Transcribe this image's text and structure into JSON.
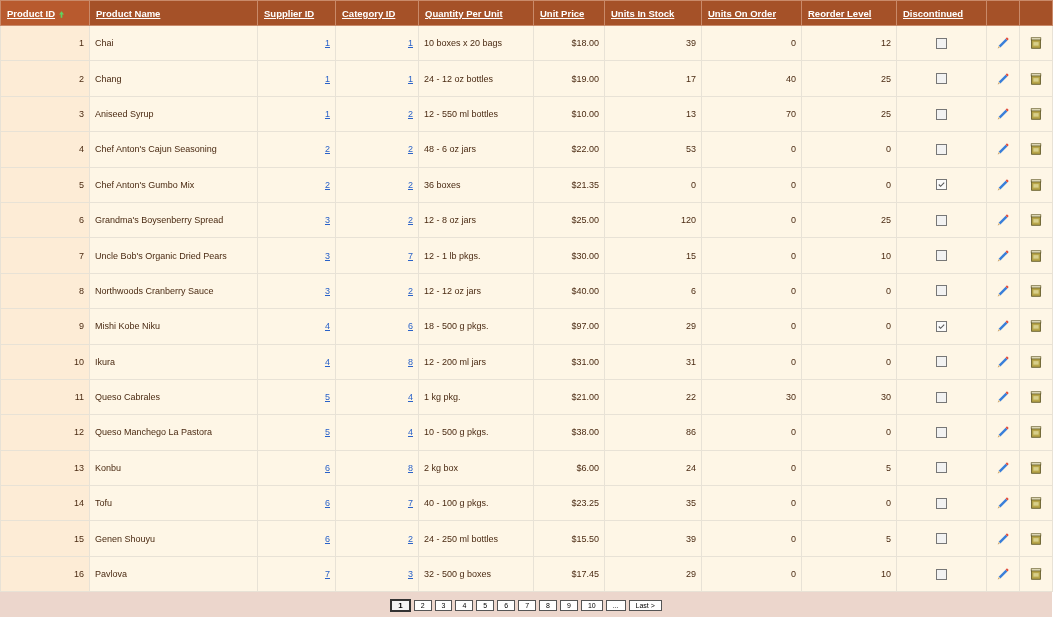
{
  "table": {
    "columns": [
      {
        "label": "Product ID",
        "sorted": true
      },
      {
        "label": "Product Name",
        "sorted": false
      },
      {
        "label": "Supplier ID",
        "sorted": false
      },
      {
        "label": "Category ID",
        "sorted": false
      },
      {
        "label": "Quantity Per Unit",
        "sorted": false
      },
      {
        "label": "Unit Price",
        "sorted": false
      },
      {
        "label": "Units In Stock",
        "sorted": false
      },
      {
        "label": "Units On Order",
        "sorted": false
      },
      {
        "label": "Reorder Level",
        "sorted": false
      },
      {
        "label": "Discontinued",
        "sorted": false
      }
    ],
    "rows": [
      {
        "cells": [
          "1",
          "Chai",
          "1",
          "1",
          "10 boxes x 20 bags",
          "$18.00",
          "39",
          "0",
          "12"
        ],
        "discontinued": false
      },
      {
        "cells": [
          "2",
          "Chang",
          "1",
          "1",
          "24 - 12 oz bottles",
          "$19.00",
          "17",
          "40",
          "25"
        ],
        "discontinued": false
      },
      {
        "cells": [
          "3",
          "Aniseed Syrup",
          "1",
          "2",
          "12 - 550 ml bottles",
          "$10.00",
          "13",
          "70",
          "25"
        ],
        "discontinued": false
      },
      {
        "cells": [
          "4",
          "Chef Anton's Cajun Seasoning",
          "2",
          "2",
          "48 - 6 oz jars",
          "$22.00",
          "53",
          "0",
          "0"
        ],
        "discontinued": false
      },
      {
        "cells": [
          "5",
          "Chef Anton's Gumbo Mix",
          "2",
          "2",
          "36 boxes",
          "$21.35",
          "0",
          "0",
          "0"
        ],
        "discontinued": true
      },
      {
        "cells": [
          "6",
          "Grandma's Boysenberry Spread",
          "3",
          "2",
          "12 - 8 oz jars",
          "$25.00",
          "120",
          "0",
          "25"
        ],
        "discontinued": false
      },
      {
        "cells": [
          "7",
          "Uncle Bob's Organic Dried Pears",
          "3",
          "7",
          "12 - 1 lb pkgs.",
          "$30.00",
          "15",
          "0",
          "10"
        ],
        "discontinued": false
      },
      {
        "cells": [
          "8",
          "Northwoods Cranberry Sauce",
          "3",
          "2",
          "12 - 12 oz jars",
          "$40.00",
          "6",
          "0",
          "0"
        ],
        "discontinued": false
      },
      {
        "cells": [
          "9",
          "Mishi Kobe Niku",
          "4",
          "6",
          "18 - 500 g pkgs.",
          "$97.00",
          "29",
          "0",
          "0"
        ],
        "discontinued": true
      },
      {
        "cells": [
          "10",
          "Ikura",
          "4",
          "8",
          "12 - 200 ml jars",
          "$31.00",
          "31",
          "0",
          "0"
        ],
        "discontinued": false
      },
      {
        "cells": [
          "11",
          "Queso Cabrales",
          "5",
          "4",
          "1 kg pkg.",
          "$21.00",
          "22",
          "30",
          "30"
        ],
        "discontinued": false
      },
      {
        "cells": [
          "12",
          "Queso Manchego La Pastora",
          "5",
          "4",
          "10 - 500 g pkgs.",
          "$38.00",
          "86",
          "0",
          "0"
        ],
        "discontinued": false
      },
      {
        "cells": [
          "13",
          "Konbu",
          "6",
          "8",
          "2 kg box",
          "$6.00",
          "24",
          "0",
          "5"
        ],
        "discontinued": false
      },
      {
        "cells": [
          "14",
          "Tofu",
          "6",
          "7",
          "40 - 100 g pkgs.",
          "$23.25",
          "35",
          "0",
          "0"
        ],
        "discontinued": false
      },
      {
        "cells": [
          "15",
          "Genen Shouyu",
          "6",
          "2",
          "24 - 250 ml bottles",
          "$15.50",
          "39",
          "0",
          "5"
        ],
        "discontinued": false
      },
      {
        "cells": [
          "16",
          "Pavlova",
          "7",
          "3",
          "32 - 500 g boxes",
          "$17.45",
          "29",
          "0",
          "10"
        ],
        "discontinued": false
      }
    ]
  },
  "pager": [
    {
      "label": "1",
      "selected": true
    },
    {
      "label": "2",
      "selected": false
    },
    {
      "label": "3",
      "selected": false
    },
    {
      "label": "4",
      "selected": false
    },
    {
      "label": "5",
      "selected": false
    },
    {
      "label": "6",
      "selected": false
    },
    {
      "label": "7",
      "selected": false
    },
    {
      "label": "8",
      "selected": false
    },
    {
      "label": "9",
      "selected": false
    },
    {
      "label": "10",
      "selected": false
    },
    {
      "label": "...",
      "selected": false
    },
    {
      "label": "Last >",
      "selected": false
    }
  ]
}
